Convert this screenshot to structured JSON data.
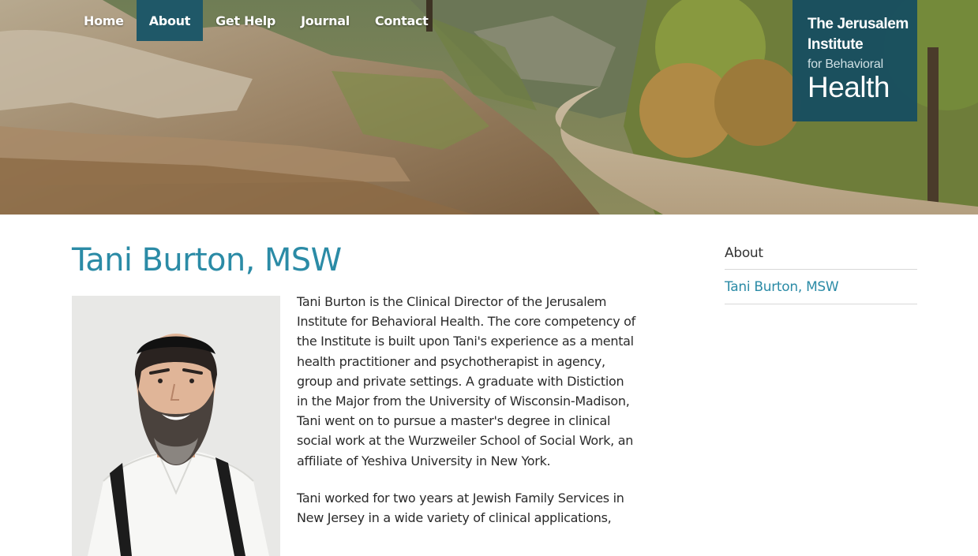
{
  "nav": {
    "items": [
      {
        "label": "Home"
      },
      {
        "label": "About",
        "active": true
      },
      {
        "label": "Get Help"
      },
      {
        "label": "Journal"
      },
      {
        "label": "Contact"
      }
    ]
  },
  "logo": {
    "line1": "The Jerusalem",
    "line2": "Institute",
    "line3": "for Behavioral",
    "line4": "Health"
  },
  "page": {
    "title": "Tani Burton, MSW",
    "paragraphs": [
      "Tani Burton is the Clinical Director of the Jerusalem Institute for Behavioral Health.  The core competency of the Institute is built upon Tani's experience as a mental health practitioner and psychotherapist in agency, group and private settings.  A graduate with Distiction in the Major from the University of Wisconsin-Madison, Tani went on to pursue a master's degree in clinical social work at the Wurzweiler School of Social Work, an affiliate of Yeshiva University in New York.",
      "Tani worked for two years at Jewish Family Services in New Jersey in a wide variety of clinical applications,"
    ]
  },
  "sidebar": {
    "heading": "About",
    "links": [
      {
        "label": "Tani Burton, MSW"
      }
    ]
  },
  "colors": {
    "accent": "#2b8ba6",
    "nav_active": "#1f5868",
    "logo_bg": "#164e60"
  }
}
